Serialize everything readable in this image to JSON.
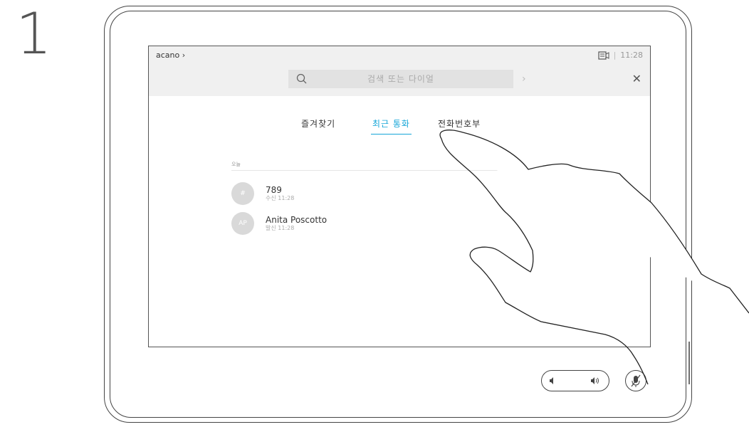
{
  "step": {
    "number": "1"
  },
  "header": {
    "brand": "acano",
    "brand_chevron": "›",
    "time": "11:28",
    "separator": "|",
    "camera_icon": "camera-screen-icon"
  },
  "search": {
    "placeholder": "검색 또는 다이얼",
    "search_icon": "search-icon",
    "go_icon": "chevron-right-icon",
    "close_icon": "close-icon"
  },
  "tabs": [
    {
      "label": "즐겨찾기",
      "active": false
    },
    {
      "label": "최근 통화",
      "active": true
    },
    {
      "label": "전화번호부",
      "active": false
    }
  ],
  "recents": {
    "section_label": "오늘",
    "items": [
      {
        "avatar": "#",
        "name": "789",
        "detail": "수신 11:28"
      },
      {
        "avatar": "AP",
        "name": "Anita Poscotto",
        "detail": "발신 11:28"
      }
    ]
  },
  "controls": {
    "volume_down_icon": "volume-down-icon",
    "volume_up_icon": "volume-up-icon",
    "mic_icon": "microphone-mute-icon"
  },
  "colors": {
    "accent": "#16a6d8",
    "topbar_bg": "#f0f0f0",
    "avatar_bg": "#d9d9d9"
  }
}
